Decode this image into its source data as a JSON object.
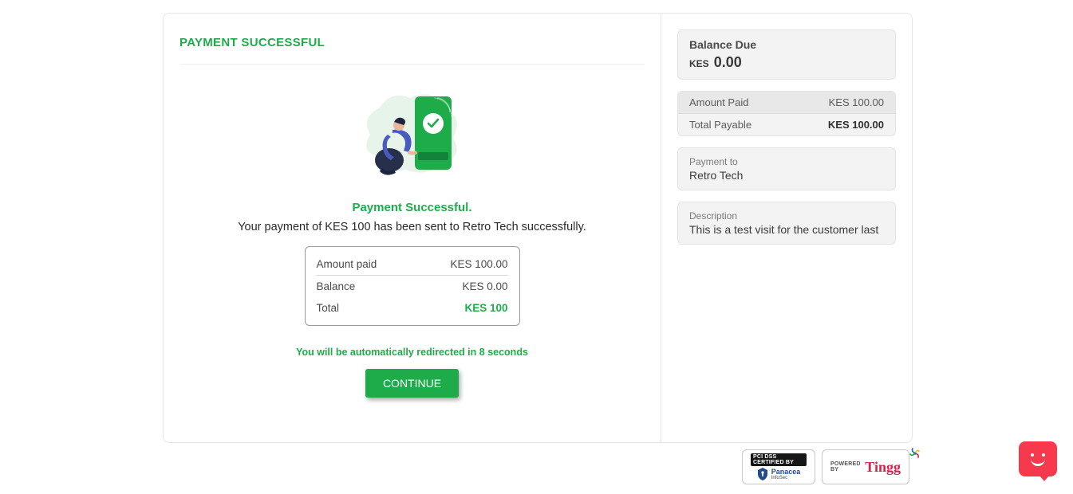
{
  "left": {
    "heading": "PAYMENT SUCCESSFUL",
    "subheading": "Payment Successful.",
    "description": "Your payment of KES 100 has been sent to Retro Tech successfully.",
    "summary": {
      "amount_paid_label": "Amount paid",
      "amount_paid_value": "KES 100.00",
      "balance_label": "Balance",
      "balance_value": "KES 0.00",
      "total_label": "Total",
      "total_value": "KES 100"
    },
    "redirect_line": "You will be automatically redirected in 8 seconds",
    "continue_label": "CONTINUE"
  },
  "right": {
    "balance_due_label": "Balance Due",
    "balance_due_currency": "KES",
    "balance_due_amount": "0.00",
    "amount_paid_label": "Amount Paid",
    "amount_paid_value": "KES 100.00",
    "total_payable_label": "Total Payable",
    "total_payable_value": "KES 100.00",
    "payment_to_label": "Payment to",
    "payment_to_value": "Retro Tech",
    "description_label": "Description",
    "description_value": "This is a test visit for the customer last"
  },
  "badges": {
    "pci_top": "PCI DSS CERTIFIED BY",
    "pci_name": "Panacea",
    "pci_sub": "InfoSec",
    "powered_by": "POWERED BY",
    "tingg": "Tingg"
  },
  "colors": {
    "accent": "#1eac4b",
    "chat": "#f6394c",
    "tingg": "#d6234c"
  }
}
